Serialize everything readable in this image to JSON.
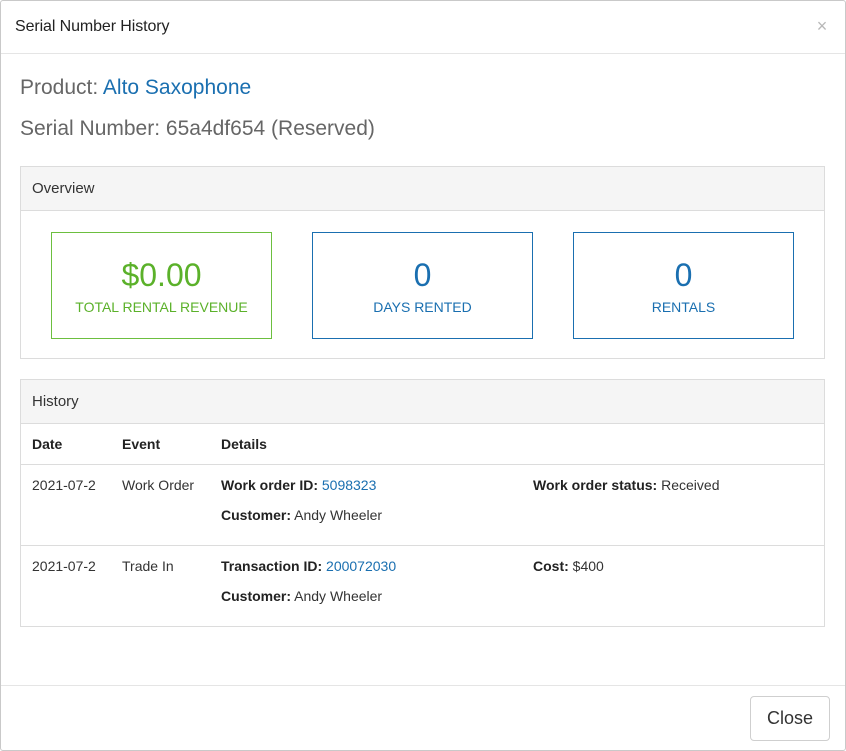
{
  "modal": {
    "title": "Serial Number History",
    "close_glyph": "×"
  },
  "product": {
    "label": "Product:",
    "name": "Alto Saxophone"
  },
  "serial": {
    "label": "Serial Number:",
    "value": "65a4df654",
    "status": "(Reserved)"
  },
  "overview": {
    "heading": "Overview",
    "stats": [
      {
        "value": "$0.00",
        "label": "TOTAL RENTAL REVENUE",
        "color": "#5bb12a"
      },
      {
        "value": "0",
        "label": "DAYS RENTED",
        "color": "#1a6fb0"
      },
      {
        "value": "0",
        "label": "RENTALS",
        "color": "#1a6fb0"
      }
    ]
  },
  "history": {
    "heading": "History",
    "columns": [
      "Date",
      "Event",
      "Details"
    ],
    "rows": [
      {
        "date": "2021-07-2",
        "event": "Work Order",
        "id_label": "Work order ID:",
        "id_value": "5098323",
        "extra_label": "Work order status:",
        "extra_value": "Received",
        "customer_label": "Customer:",
        "customer_value": "Andy Wheeler"
      },
      {
        "date": "2021-07-2",
        "event": "Trade In",
        "id_label": "Transaction ID:",
        "id_value": "200072030",
        "extra_label": "Cost:",
        "extra_value": "$400",
        "customer_label": "Customer:",
        "customer_value": "Andy Wheeler"
      }
    ]
  },
  "footer": {
    "close_label": "Close"
  }
}
